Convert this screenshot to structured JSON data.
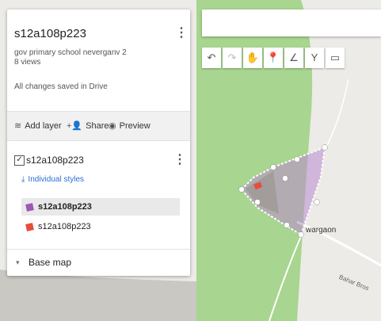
{
  "map": {
    "title": "s12a108p223",
    "description": "gov primary school neverganv 2",
    "views": "8 views",
    "save_status": "All changes saved in Drive",
    "actions": {
      "add_layer": "Add layer",
      "share": "Share",
      "preview": "Preview"
    }
  },
  "layer": {
    "name": "s12a108p223",
    "style_label": "Individual styles",
    "features": [
      {
        "name": "s12a108p223",
        "color": "#9b59b6",
        "selected": true
      },
      {
        "name": "s12a108p223",
        "color": "#e74c3c",
        "selected": false
      }
    ]
  },
  "basemap": {
    "label": "Base map"
  },
  "canvas": {
    "place_label": "wargaon",
    "road_label": "Bahar Bros"
  },
  "colors": {
    "forest": "#a8d58f",
    "polygon_fill": "#b98ad0",
    "polygon_stroke": "#ffffff",
    "accent_blue": "#2a6fd1"
  },
  "toolbar": {
    "icons": [
      "undo-icon",
      "redo-icon",
      "hand-icon",
      "marker-icon",
      "line-icon",
      "directions-icon",
      "ruler-icon"
    ]
  }
}
